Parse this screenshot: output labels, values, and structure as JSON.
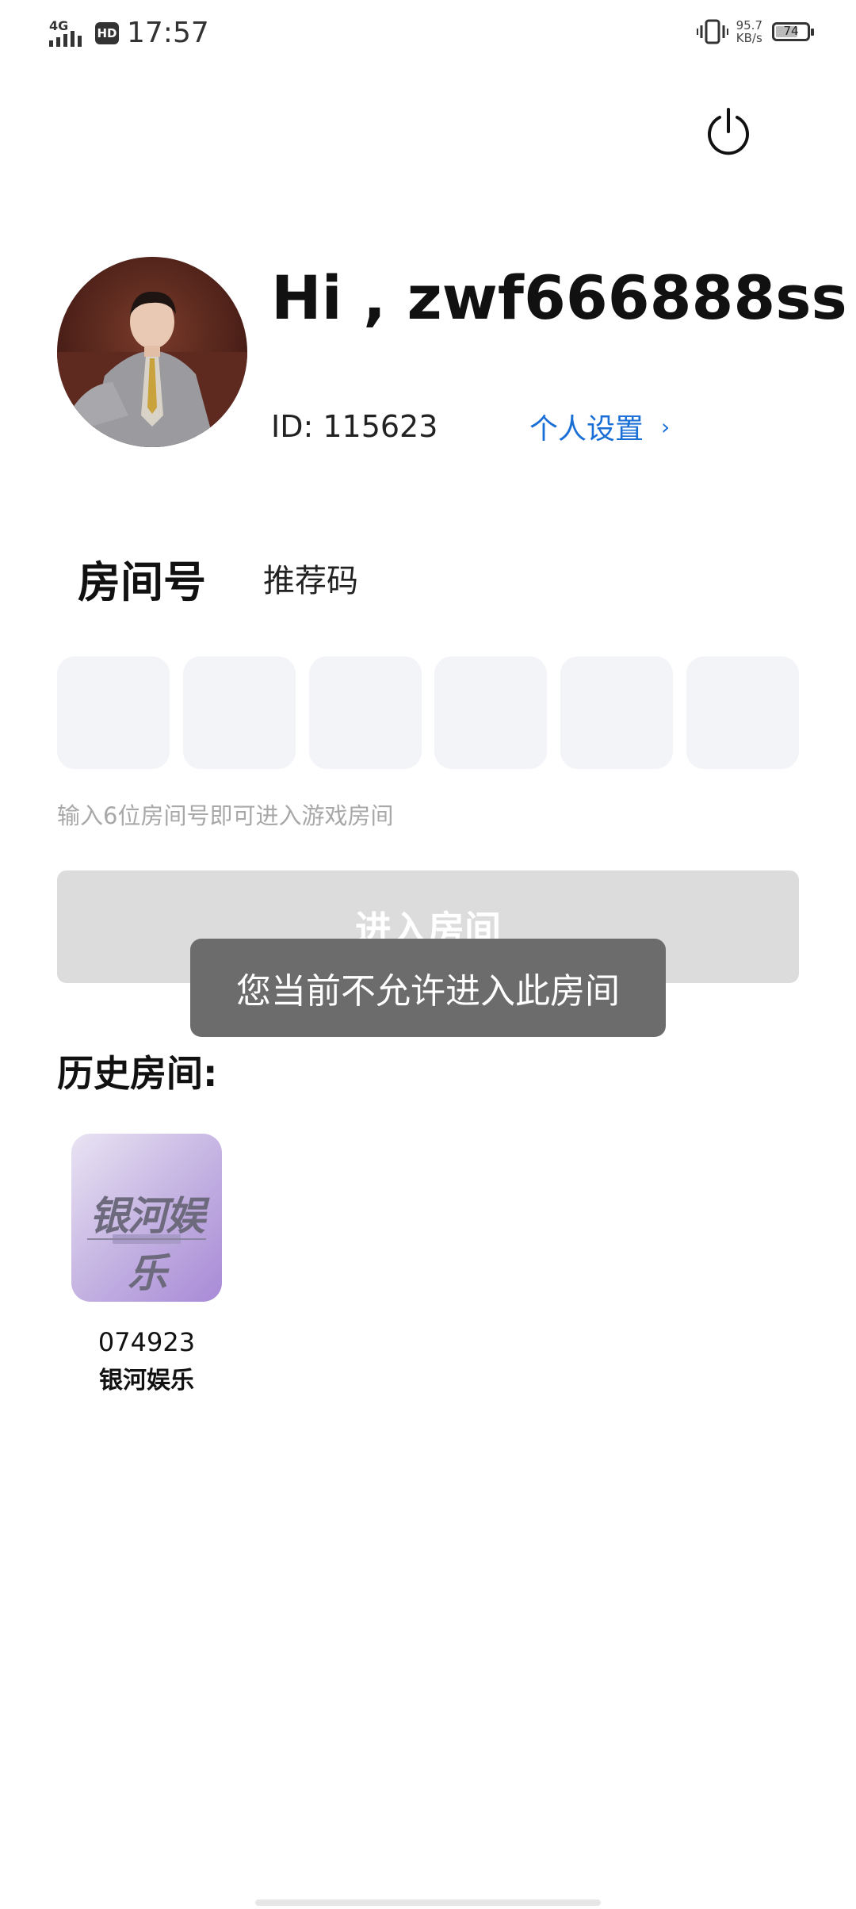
{
  "status_bar": {
    "network": "4G",
    "hd": "HD",
    "time": "17:57",
    "speed_value": "95.7",
    "speed_unit": "KB/s",
    "battery": "74"
  },
  "header": {
    "power_icon": "power-icon"
  },
  "profile": {
    "greeting": "Hi , zwf666888ss",
    "user_id": "ID: 115623",
    "settings_label": "个人设置",
    "settings_chevron": "›"
  },
  "tabs": {
    "room_number": "房间号",
    "referral_code": "推荐码"
  },
  "room_input": {
    "digits": [
      "",
      "",
      "",
      "",
      "",
      ""
    ],
    "hint": "输入6位房间号即可进入游戏房间"
  },
  "enter_button": {
    "label": "进入房间"
  },
  "toast": {
    "message": "您当前不允许进入此房间"
  },
  "history": {
    "title": "历史房间:",
    "items": [
      {
        "room_id": "074923",
        "name": "银河娱乐",
        "thumb_text": "银河娱乐"
      }
    ]
  }
}
